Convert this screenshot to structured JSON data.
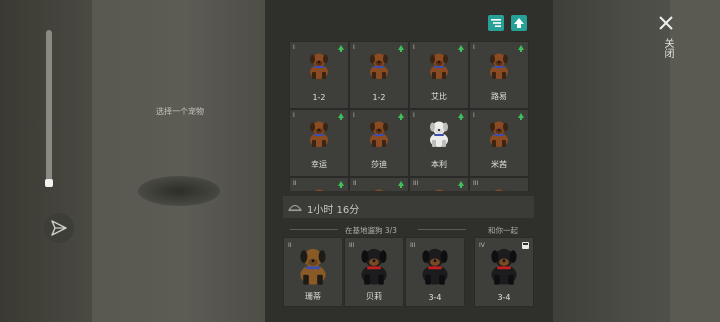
{
  "left": {
    "select_hint": "选择一个宠物"
  },
  "close": {
    "label": "关闭"
  },
  "colors": {
    "accent": "#27a097",
    "upgrade": "#3fbf5a",
    "panel": "#2f302c"
  },
  "grid_pets": [
    {
      "level": "I",
      "name": "1-2",
      "upgrade": true
    },
    {
      "level": "I",
      "name": "1-2",
      "upgrade": true
    },
    {
      "level": "I",
      "name": "艾比",
      "upgrade": true
    },
    {
      "level": "I",
      "name": "路易",
      "upgrade": true
    },
    {
      "level": "I",
      "name": "幸运",
      "upgrade": true
    },
    {
      "level": "I",
      "name": "莎迪",
      "upgrade": true
    },
    {
      "level": "I",
      "name": "本利",
      "upgrade": true
    },
    {
      "level": "I",
      "name": "米茜",
      "upgrade": true
    },
    {
      "level": "II",
      "name": "",
      "upgrade": true
    },
    {
      "level": "II",
      "name": "",
      "upgrade": true
    },
    {
      "level": "III",
      "name": "",
      "upgrade": true
    },
    {
      "level": "III",
      "name": "",
      "upgrade": false
    }
  ],
  "timer": {
    "text": "1小时 16分"
  },
  "base_section": {
    "label": "在基地遛狗 3/3"
  },
  "with_you_section": {
    "label": "和你一起"
  },
  "base_dogs": [
    {
      "level": "II",
      "name": "珊蒂"
    },
    {
      "level": "III",
      "name": "贝莉"
    },
    {
      "level": "III",
      "name": "3-4"
    }
  ],
  "companion": {
    "level": "IV",
    "name": "3-4"
  }
}
